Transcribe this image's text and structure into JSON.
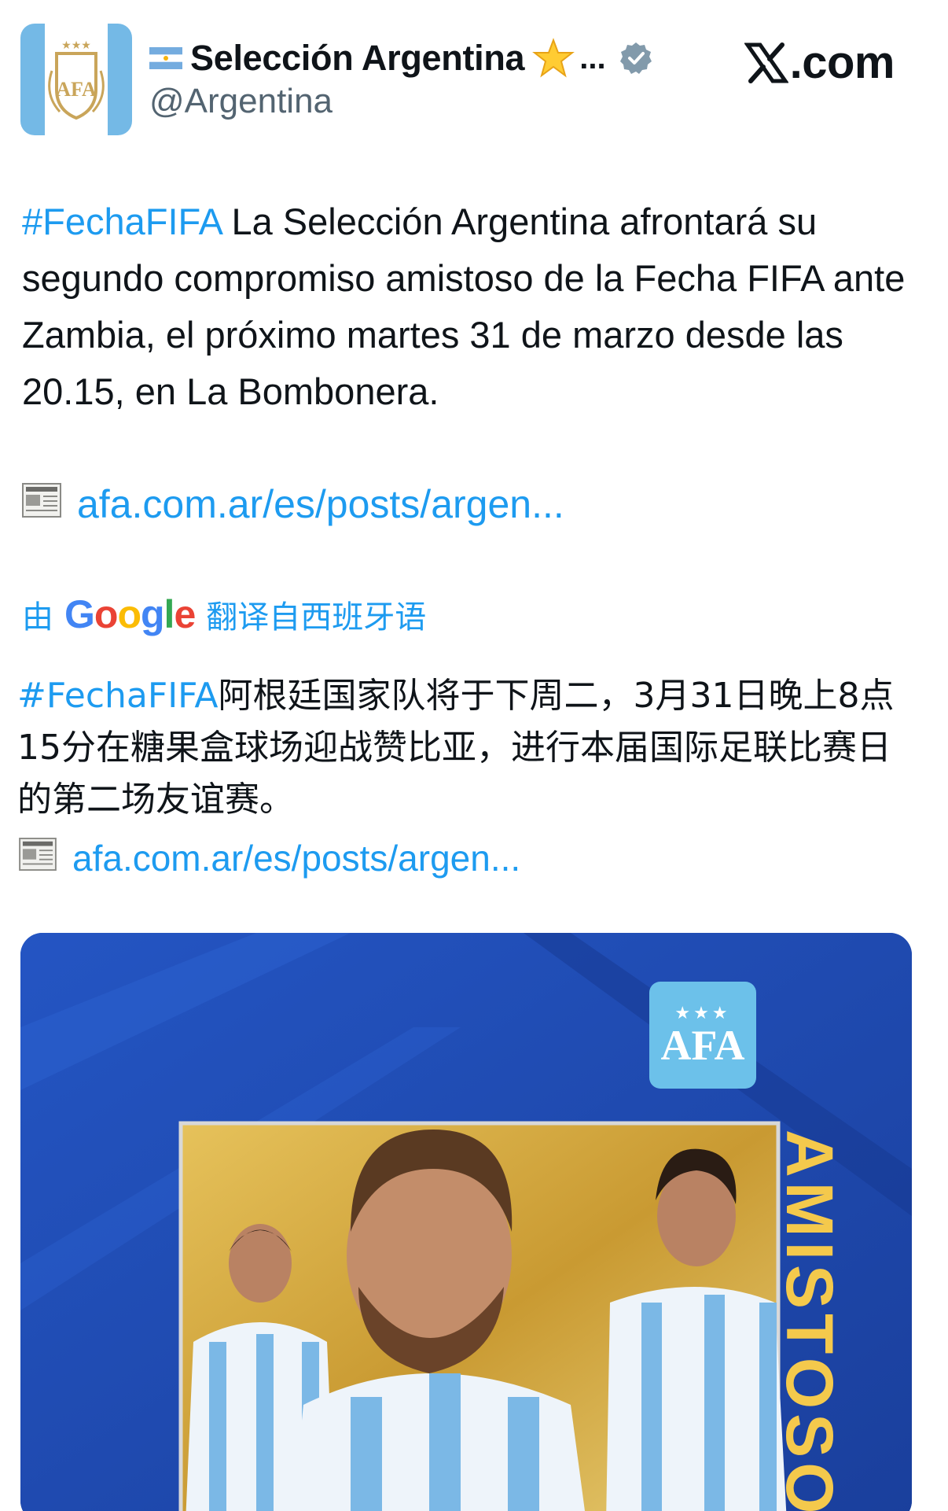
{
  "header": {
    "display_name": "Selección Argentina",
    "ellipsis": "...",
    "handle": "@Argentina",
    "site": ".com",
    "flag_icon": "argentina-flag-icon",
    "star_icon": "star-emoji-icon",
    "verified_icon": "verified-badge-icon"
  },
  "tweet": {
    "hashtag": "#FechaFIFA",
    "text": " La Selección Argentina afrontará su segundo compromiso amistoso de la Fecha FIFA ante Zambia, el próximo martes 31 de marzo desde las 20.15, en La Bombonera.",
    "link": "afa.com.ar/es/posts/argen..."
  },
  "translation": {
    "by": "由",
    "google": [
      "G",
      "o",
      "o",
      "g",
      "l",
      "e"
    ],
    "label": "翻译自西班牙语",
    "hashtag": "#FechaFIFA",
    "text": "阿根廷国家队将于下周二，3月31日晚上8点15分在糖果盒球场迎战赞比亚，进行本届国际足联比赛日的第二场友谊赛。",
    "link": "afa.com.ar/es/posts/argen..."
  },
  "media": {
    "badge_stars": "★★★",
    "badge_text": "AFA",
    "vertical_word": "AMISTOSO"
  },
  "colors": {
    "link": "#1d9bf0",
    "text": "#0f1419",
    "muted": "#536471",
    "media_blue": "#1f48b0",
    "gold": "#d9b04a"
  }
}
